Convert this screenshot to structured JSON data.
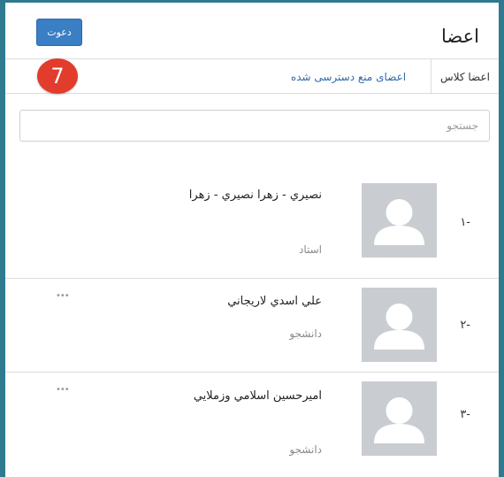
{
  "header": {
    "title": "اعضا",
    "invite_label": "دعوت"
  },
  "tabs": {
    "members": "اعضا کلاس",
    "blocked": "اعضای منع دسترسی شده"
  },
  "badge": {
    "number": "7",
    "color": "#e23c2c"
  },
  "search": {
    "placeholder": "جستجو"
  },
  "members": [
    {
      "number": "-۱",
      "name": "نصيري - زهرا نصيري - زهرا",
      "role": "استاد",
      "has_menu": false
    },
    {
      "number": "-۲",
      "name": "علي اسدي لاريجاني",
      "role": "دانشجو",
      "has_menu": true,
      "menu_icon": "•••"
    },
    {
      "number": "-۳",
      "name": "اميرحسين اسلامي وزملايي",
      "role": "دانشجو",
      "has_menu": true,
      "menu_icon": "•••"
    }
  ],
  "colors": {
    "frame": "#2f7a8e",
    "accent": "#3a7ec4",
    "link": "#2f6aa8",
    "avatar_bg": "#c9cdd2"
  }
}
